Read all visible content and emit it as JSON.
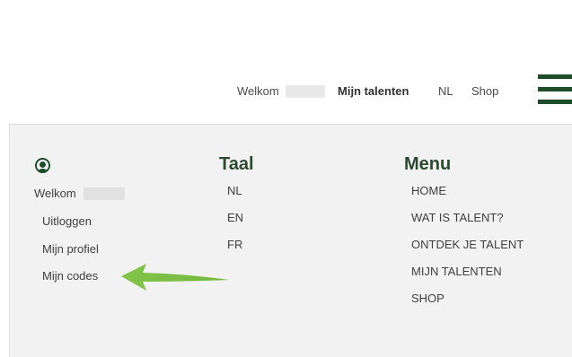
{
  "header": {
    "welcome": "Welkom",
    "my_talents": "Mijn talenten",
    "language": "NL",
    "shop": "Shop"
  },
  "account": {
    "welcome": "Welkom",
    "items": [
      "Uitloggen",
      "Mijn profiel",
      "Mijn codes"
    ]
  },
  "language_section": {
    "title": "Taal",
    "items": [
      "NL",
      "EN",
      "FR"
    ]
  },
  "menu_section": {
    "title": "Menu",
    "items": [
      "HOME",
      "WAT IS TALENT?",
      "ONTDEK JE TALENT",
      "MIJN TALENTEN",
      "SHOP"
    ]
  },
  "colors": {
    "brand_green": "#1e4d2b",
    "arrow_green": "#7dc242",
    "panel_bg": "#f2f2f2"
  },
  "icons": {
    "hamburger": "hamburger-menu-icon",
    "user": "user-circle-icon",
    "annotation": "arrow-left-icon"
  }
}
